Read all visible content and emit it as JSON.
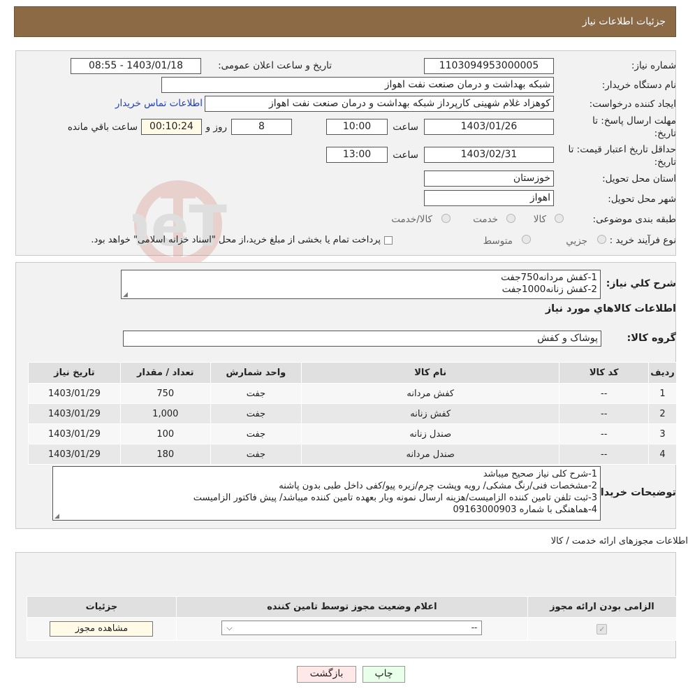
{
  "header": {
    "title": "جزئیات اطلاعات نیاز"
  },
  "form": {
    "need_number_label": "شماره نیاز:",
    "need_number": "1103094953000005",
    "announce_label": "تاریخ و ساعت اعلان عمومی:",
    "announce_value": "1403/01/18 - 08:55",
    "buyer_org_label": "نام دستگاه خریدار:",
    "buyer_org": "شبکه بهداشت و درمان صنعت نفت اهواز",
    "requester_label": "ایجاد کننده درخواست:",
    "requester": "کوهزاد غلام شهینی کارپرداز شبکه بهداشت و درمان صنعت نفت اهواز",
    "contact_link": "اطلاعات تماس خریدار",
    "deadline_label_1": "مهلت ارسال پاسخ: تا",
    "deadline_label_2": "تاریخ:",
    "deadline_date": "1403/01/26",
    "time_label": "ساعت",
    "deadline_time": "10:00",
    "days_value": "8",
    "days_label": "روز و",
    "remaining_time": "00:10:24",
    "remaining_label": "ساعت باقي مانده",
    "validity_label_1": "حداقل تاریخ اعتبار قیمت: تا",
    "validity_label_2": "تاریخ:",
    "validity_date": "1403/02/31",
    "validity_time": "13:00",
    "province_label": "استان محل تحویل:",
    "province": "خوزستان",
    "city_label": "شهر محل تحویل:",
    "city": "اهواز",
    "category_label": "طبقه بندی موضوعی:",
    "category_options": [
      "کالا",
      "خدمت",
      "کالا/خدمت"
    ],
    "process_label": "نوع فرآیند خرید :",
    "process_options": [
      "جزیي",
      "متوسط"
    ],
    "process_note": "پرداخت تمام یا بخشی از مبلغ خرید،از محل \"اسناد خزانه اسلامی\" خواهد بود."
  },
  "needs": {
    "summary_label": "شرح کلي نیاز:",
    "summary_lines": [
      "1-کفش مردانه750جفت",
      "2-کفش زنانه1000جفت"
    ],
    "goods_title": "اطلاعات کالاهاي مورد نیاز",
    "group_label": "گروه کالا:",
    "group_value": "پوشاک و کفش",
    "table": {
      "headers": [
        "ردیف",
        "کد کالا",
        "نام کالا",
        "واحد شمارش",
        "تعداد / مقدار",
        "تاریخ نیاز"
      ],
      "rows": [
        [
          "1",
          "--",
          "کفش مردانه",
          "جفت",
          "750",
          "1403/01/29"
        ],
        [
          "2",
          "--",
          "کفش زنانه",
          "جفت",
          "1,000",
          "1403/01/29"
        ],
        [
          "3",
          "--",
          "صندل زنانه",
          "جفت",
          "100",
          "1403/01/29"
        ],
        [
          "4",
          "--",
          "صندل مردانه",
          "جفت",
          "180",
          "1403/01/29"
        ]
      ]
    },
    "buyer_notes_label": "توضیحات خریدار:",
    "buyer_notes_lines": [
      "1-شرح کلی نیاز صحیح میباشد",
      "2-مشخصات فنی/رنگ مشکی/ رویه وپشت چرم/زیره پیو/کفی داخل طبی بدون پاشنه",
      "3-ثبت تلفن تامین کننده الزامیست/هزینه ارسال نمونه وبار بعهده تامین کننده میباشد/ پیش فاکتور الزامیست",
      "4-هماهنگی با شماره 09163000903"
    ]
  },
  "permits": {
    "title": "اطلاعات مجوزهای ارائه خدمت / کالا",
    "headers": [
      "الزامی بودن ارائه مجوز",
      "اعلام وضعیت مجوز توسط تامین کننده",
      "جزئیات"
    ],
    "select_value": "--",
    "view_button": "مشاهده مجوز"
  },
  "footer": {
    "print_button": "چاپ",
    "back_button": "بازگشت"
  },
  "watermark": {
    "text": "AriaTender.neT"
  },
  "colors": {
    "header_bg": "#8b6a45",
    "link": "#1a3ccf",
    "print_bg": "#eaffea",
    "back_bg": "#ffe8e8"
  }
}
